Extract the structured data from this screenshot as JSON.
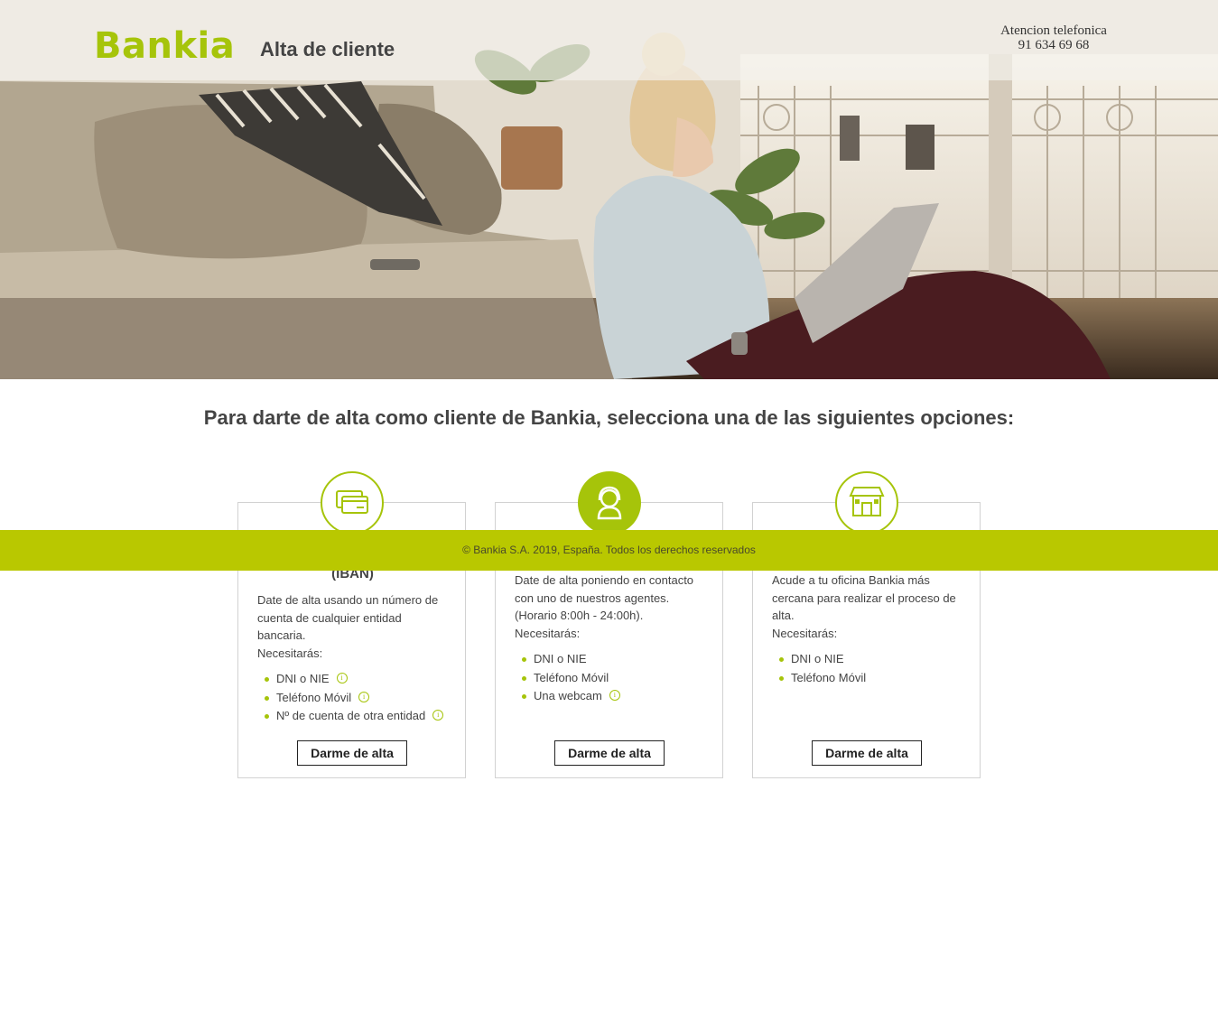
{
  "header": {
    "logo": "Bankia",
    "title": "Alta de cliente",
    "phone_label": "Atencion telefonica",
    "phone_number": "91 634 69 68"
  },
  "main": {
    "heading": "Para darte de alta como cliente de Bankia, selecciona una de las siguientes opciones:"
  },
  "cards": [
    {
      "icon": "credit-card-icon",
      "title_visible": "(IBAN)",
      "description": [
        "Date de alta usando un número de",
        "cuenta de cualquier entidad",
        "bancaria.",
        "Necesitarás:"
      ],
      "requirements": [
        "DNI o NIE",
        "Teléfono Móvil",
        "Nº de cuenta de otra entidad"
      ],
      "button": "Darme de alta"
    },
    {
      "icon": "agent-icon",
      "description": [
        "Date de alta poniendo en contacto",
        "con uno de nuestros agentes.",
        "(Horario 8:00h - 24:00h).",
        "Necesitarás:"
      ],
      "requirements": [
        "DNI o NIE",
        "Teléfono Móvil",
        "Una webcam"
      ],
      "button": "Darme de alta"
    },
    {
      "icon": "bank-office-icon",
      "description": [
        "Acude a tu oficina Bankia más",
        "cercana para realizar el proceso de",
        "alta.",
        "Necesitarás:"
      ],
      "requirements": [
        "DNI o NIE",
        "Teléfono Móvil"
      ],
      "button": "Darme de alta"
    }
  ],
  "info_icon_glyph": "i",
  "footer": {
    "copyright": "© Bankia S.A. 2019, España. Todos los derechos reservados"
  },
  "colors": {
    "brand": "#a6c40a",
    "footer_bg": "#b9c800"
  }
}
